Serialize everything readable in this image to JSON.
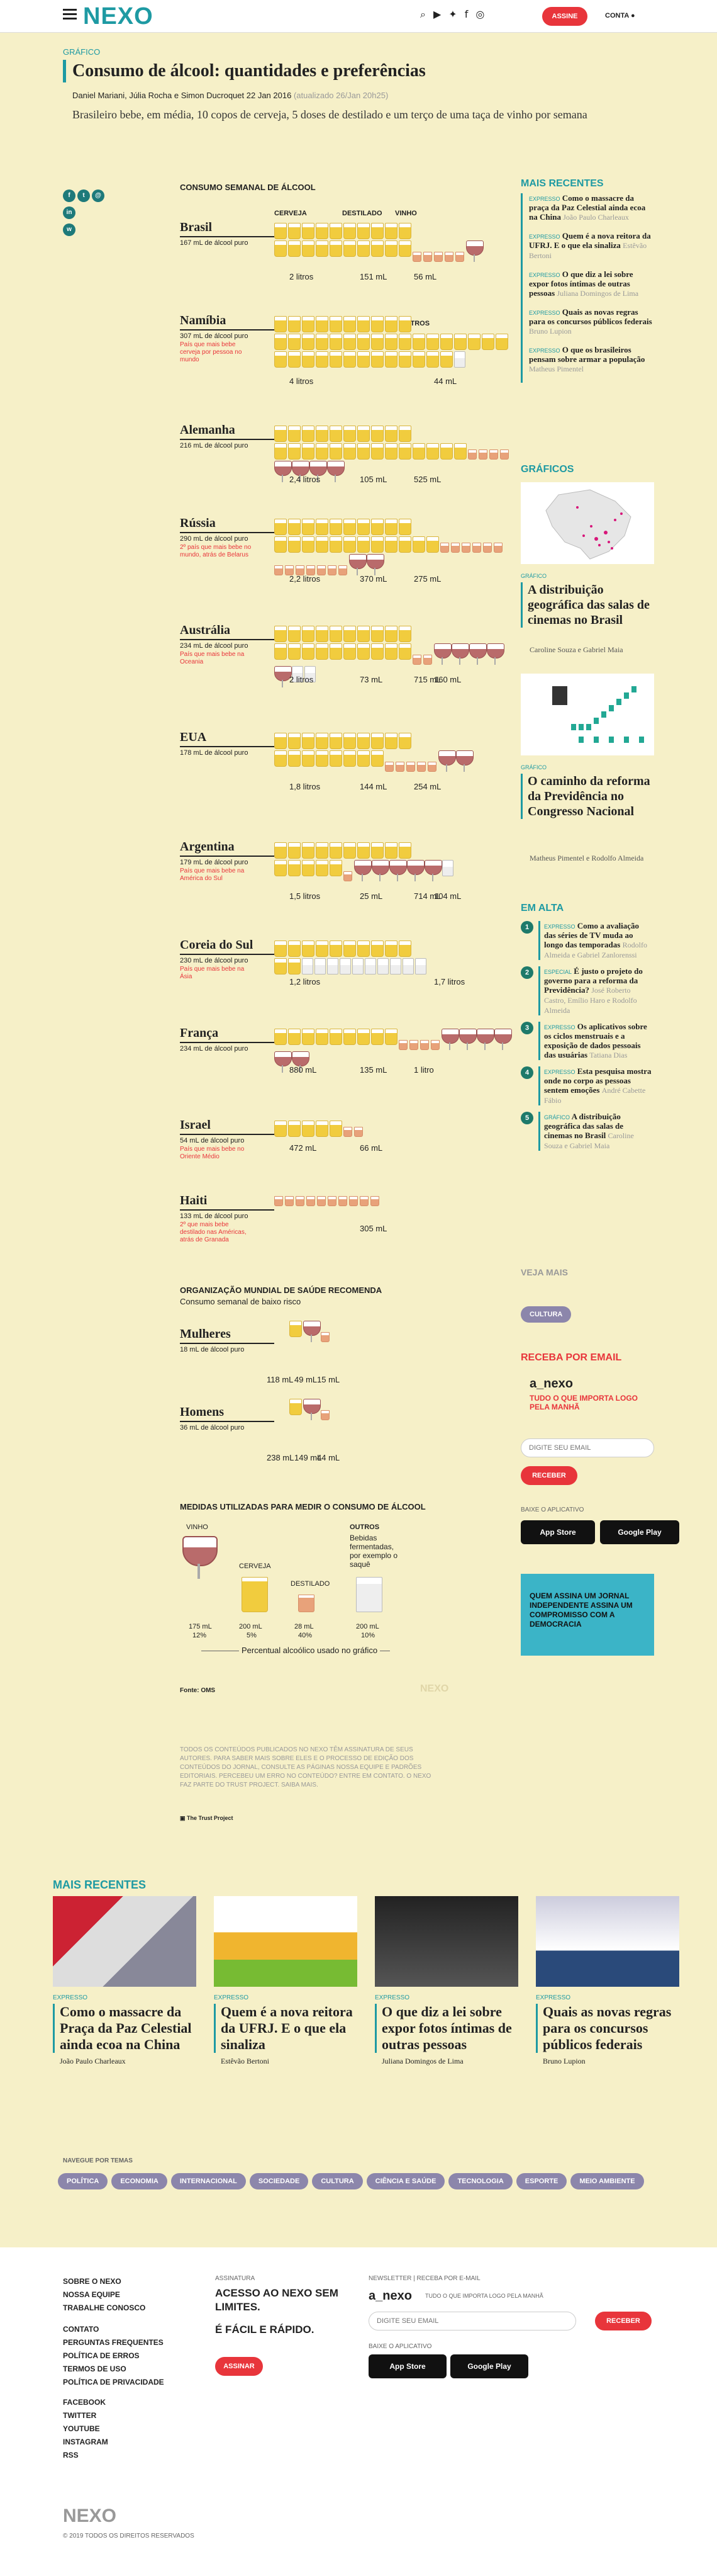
{
  "header": {
    "logo": "NEXO",
    "assine": "ASSINE",
    "conta": "CONTA"
  },
  "article": {
    "section": "GRÁFICO",
    "title": "Consumo de álcool: quantidades e preferências",
    "byline": "Daniel Mariani, Júlia Rocha e Simon Ducroquet 22 Jan 2016",
    "updated": "(atualizado 26/Jan 20h25)",
    "lead": "Brasileiro bebe, em média, 10 copos de cerveja, 5 doses de destilado e um terço de uma taça de vinho por semana"
  },
  "share": [
    "f",
    "t",
    "@",
    "in",
    "w"
  ],
  "infographic": {
    "title": "CONSUMO SEMANAL DE ÁLCOOL",
    "columns": {
      "beer": "CERVEJA",
      "spirit": "DESTILADO",
      "wine": "VINHO",
      "other": "OUTROS"
    },
    "countries": [
      {
        "name": "Brasil",
        "pure": "167 mL de álcool puro",
        "note": "",
        "beer": "2 litros",
        "spirit": "151 mL",
        "wine": "56 mL",
        "other": ""
      },
      {
        "name": "Namíbia",
        "pure": "307 mL de álcool puro",
        "note": "País que mais bebe cerveja por pessoa no mundo",
        "beer": "4 litros",
        "spirit": "",
        "wine": "",
        "other": "44 mL"
      },
      {
        "name": "Alemanha",
        "pure": "216 mL de álcool puro",
        "note": "",
        "beer": "2,4 litros",
        "spirit": "105 mL",
        "wine": "525 mL",
        "other": ""
      },
      {
        "name": "Rússia",
        "pure": "290 mL de álcool puro",
        "note": "2º país que mais bebe no mundo, atrás de Belarus",
        "beer": "2,2 litros",
        "spirit": "370 mL",
        "wine": "275 mL",
        "other": ""
      },
      {
        "name": "Austrália",
        "pure": "234 mL de álcool puro",
        "note": "País que mais bebe na Oceania",
        "beer": "2 litros",
        "spirit": "73 mL",
        "wine": "715 mL",
        "other": "160 mL"
      },
      {
        "name": "EUA",
        "pure": "178 mL de álcool puro",
        "note": "",
        "beer": "1,8 litros",
        "spirit": "144 mL",
        "wine": "254 mL",
        "other": ""
      },
      {
        "name": "Argentina",
        "pure": "179 mL de álcool puro",
        "note": "País que mais bebe na América do Sul",
        "beer": "1,5 litros",
        "spirit": "25 mL",
        "wine": "714 mL",
        "other": "104 mL"
      },
      {
        "name": "Coreia do Sul",
        "pure": "230 mL de álcool puro",
        "note": "País que mais bebe na Ásia",
        "beer": "1,2 litros",
        "spirit": "",
        "wine": "",
        "other": "1,7 litros"
      },
      {
        "name": "França",
        "pure": "234 mL de álcool puro",
        "note": "",
        "beer": "880 mL",
        "spirit": "135 mL",
        "wine": "1 litro",
        "other": ""
      },
      {
        "name": "Israel",
        "pure": "54 mL de álcool puro",
        "note": "País que mais bebe no Oriente Médio",
        "beer": "472 mL",
        "spirit": "66 mL",
        "wine": "",
        "other": ""
      },
      {
        "name": "Haiti",
        "pure": "133 mL de álcool puro",
        "note": "2º que mais bebe destilado nas Américas, atrás de Granada",
        "beer": "",
        "spirit": "305 mL",
        "wine": "",
        "other": ""
      }
    ],
    "who": {
      "title": "ORGANIZAÇÃO MUNDIAL DE SAÚDE RECOMENDA",
      "sub": "Consumo semanal de baixo risco",
      "rows": [
        {
          "name": "Mulheres",
          "pure": "18 mL de álcool puro",
          "beer": "118 mL",
          "spirit": "49 mL",
          "wine": "15 mL"
        },
        {
          "name": "Homens",
          "pure": "36 mL de álcool puro",
          "beer": "238 mL",
          "spirit": "149 mL",
          "wine": "44 mL"
        }
      ]
    },
    "measures": {
      "title": "MEDIDAS UTILIZADAS PARA MEDIR O CONSUMO DE ÁLCOOL",
      "wine": {
        "label": "VINHO",
        "vol": "175 mL",
        "pct": "12%"
      },
      "beer": {
        "label": "CERVEJA",
        "vol": "200 mL",
        "pct": "5%"
      },
      "spirit": {
        "label": "DESTILADO",
        "vol": "28 mL",
        "pct": "40%"
      },
      "other": {
        "label": "OUTROS",
        "desc": "Bebidas fermentadas, por exemplo o saquê",
        "vol": "200 mL",
        "pct": "10%"
      },
      "pct_label": "Percentual alcoólico usado no gráfico"
    },
    "source": "Fonte: OMS",
    "watermark": "NEXO",
    "disclaimer": "TODOS OS CONTEÚDOS PUBLICADOS NO NEXO TÊM ASSINATURA DE SEUS AUTORES. PARA SABER MAIS SOBRE ELES E O PROCESSO DE EDIÇÃO DOS CONTEÚDOS DO JORNAL, CONSULTE AS PÁGINAS NOSSA EQUIPE E PADRÕES EDITORIAIS. PERCEBEU UM ERRO NO CONTEÚDO? ENTRE EM CONTATO. O NEXO FAZ PARTE DO TRUST PROJECT. SAIBA MAIS.",
    "trust": "The Trust Project"
  },
  "sidebar": {
    "recent_title": "MAIS RECENTES",
    "recent": [
      {
        "k": "EXPRESSO",
        "t": "Como o massacre da praça da Paz Celestial ainda ecoa na China",
        "a": "João Paulo Charleaux"
      },
      {
        "k": "EXPRESSO",
        "t": "Quem é a nova reitora da UFRJ. E o que ela sinaliza",
        "a": "Estêvão Bertoni"
      },
      {
        "k": "EXPRESSO",
        "t": "O que diz a lei sobre expor fotos íntimas de outras pessoas",
        "a": "Juliana Domingos de Lima"
      },
      {
        "k": "EXPRESSO",
        "t": "Quais as novas regras para os concursos públicos federais",
        "a": "Bruno Lupion"
      },
      {
        "k": "EXPRESSO",
        "t": "O que os brasileiros pensam sobre armar a população",
        "a": "Matheus Pimentel"
      }
    ],
    "graphics_title": "GRÁFICOS",
    "graphics": [
      {
        "k": "GRÁFICO",
        "t": "A distribuição geográfica das salas de cinemas no Brasil",
        "a": "Caroline Souza e Gabriel Maia"
      },
      {
        "k": "GRÁFICO",
        "t": "O caminho da reforma da Previdência no Congresso Nacional",
        "a": "Matheus Pimentel e Rodolfo Almeida"
      }
    ],
    "trending_title": "EM ALTA",
    "trending": [
      {
        "n": "1",
        "k": "EXPRESSO",
        "t": "Como a avaliação das séries de TV muda ao longo das temporadas",
        "a": "Rodolfo Almeida e Gabriel Zanlorenssi"
      },
      {
        "n": "2",
        "k": "ESPECIAL",
        "t": "É justo o projeto do governo para a reforma da Previdência?",
        "a": "José Roberto Castro, Emílio Haro e Rodolfo Almeida"
      },
      {
        "n": "3",
        "k": "EXPRESSO",
        "t": "Os aplicativos sobre os ciclos menstruais e a exposição de dados pessoais das usuárias",
        "a": "Tatiana Dias"
      },
      {
        "n": "4",
        "k": "EXPRESSO",
        "t": "Esta pesquisa mostra onde no corpo as pessoas sentem emoções",
        "a": "André Cabette Fábio"
      },
      {
        "n": "5",
        "k": "GRÁFICO",
        "t": "A distribuição geográfica das salas de cinemas no Brasil",
        "a": "Caroline Souza e Gabriel Maia"
      }
    ],
    "veja_mais": "VEJA MAIS",
    "veja_tag": "CULTURA",
    "newsletter": {
      "title": "RECEBA POR EMAIL",
      "brand": "a_nexo",
      "sub": "TUDO O QUE IMPORTA LOGO PELA MANHÃ",
      "placeholder": "DIGITE SEU EMAIL",
      "button": "RECEBER"
    },
    "app": {
      "title": "BAIXE O APLICATIVO",
      "appstore": "App Store",
      "gplay": "Google Play"
    },
    "promo": "QUEM ASSINA UM JORNAL INDEPENDENTE ASSINA UM COMPROMISSO COM A DEMOCRACIA"
  },
  "bottom": {
    "recent_title": "MAIS RECENTES",
    "cards": [
      {
        "k": "EXPRESSO",
        "t": "Como o massacre da Praça da Paz Celestial ainda ecoa na China",
        "a": "João Paulo Charleaux"
      },
      {
        "k": "EXPRESSO",
        "t": "Quem é a nova reitora da UFRJ. E o que ela sinaliza",
        "a": "Estêvão Bertoni"
      },
      {
        "k": "EXPRESSO",
        "t": "O que diz a lei sobre expor fotos íntimas de outras pessoas",
        "a": "Juliana Domingos de Lima"
      },
      {
        "k": "EXPRESSO",
        "t": "Quais as novas regras para os concursos públicos federais",
        "a": "Bruno Lupion"
      }
    ],
    "nav_title": "NAVEGUE POR TEMAS",
    "tags": [
      "POLÍTICA",
      "ECONOMIA",
      "INTERNACIONAL",
      "SOCIEDADE",
      "CULTURA",
      "CIÊNCIA E SAÚDE",
      "TECNOLOGIA",
      "ESPORTE",
      "MEIO AMBIENTE"
    ]
  },
  "footer": {
    "col1": [
      "SOBRE O NEXO",
      "NOSSA EQUIPE",
      "TRABALHE CONOSCO"
    ],
    "col2": [
      "CONTATO",
      "PERGUNTAS FREQUENTES",
      "POLÍTICA DE ERROS",
      "TERMOS DE USO",
      "POLÍTICA DE PRIVACIDADE"
    ],
    "social": [
      "FACEBOOK",
      "TWITTER",
      "YOUTUBE",
      "INSTAGRAM",
      "RSS"
    ],
    "assinatura": {
      "h": "ASSINATURA",
      "t1": "ACESSO AO NEXO SEM LIMITES.",
      "t2": "É FÁCIL E RÁPIDO.",
      "btn": "ASSINAR"
    },
    "newsletter": {
      "h": "NEWSLETTER | RECEBA POR E-MAIL",
      "brand": "a_nexo",
      "sub": "TUDO O QUE IMPORTA LOGO PELA MANHÃ",
      "placeholder": "DIGITE SEU EMAIL",
      "btn": "RECEBER"
    },
    "app_h": "BAIXE O APLICATIVO",
    "logo": "NEXO",
    "copy": "© 2019 TODOS OS DIREITOS RESERVADOS"
  }
}
